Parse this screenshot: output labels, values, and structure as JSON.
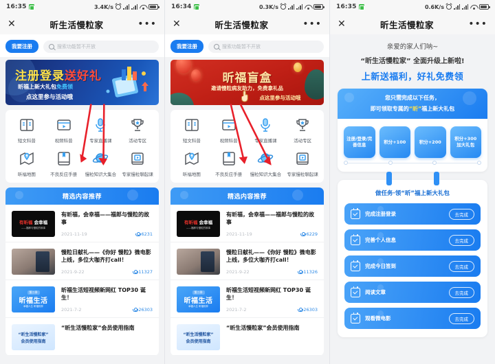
{
  "panels": [
    {
      "status": {
        "time": "16:35",
        "net_speed": "3.4K/s"
      },
      "title": "昕生活慢粒家",
      "close_label": "✕",
      "more_label": "•••",
      "register_button": "我要注册",
      "search_placeholder": "搜索功能暂不开放",
      "banner": {
        "kind": "blue",
        "title_part1": "注册登录",
        "title_part2": "送好礼",
        "subtitle_main": "昕福上新大礼包",
        "subtitle_accent": "免费领",
        "cta": "点这里参与活动哦"
      }
    },
    {
      "status": {
        "time": "16:34",
        "net_speed": "0.3K/s"
      },
      "title": "昕生活慢粒家",
      "close_label": "✕",
      "more_label": "•••",
      "register_button": "我要注册",
      "search_placeholder": "搜索功能暂不开放",
      "banner": {
        "kind": "red",
        "title": "昕福盲盒",
        "subtitle": "邀请慢粒病友助力，免费拿礼品",
        "cta": "点这里参与活动哦"
      }
    }
  ],
  "grid": {
    "items": [
      {
        "label": "短文科普",
        "icon": "book-open-icon"
      },
      {
        "label": "视频科普",
        "icon": "video-play-icon"
      },
      {
        "label": "专家直播课",
        "icon": "microphone-icon"
      },
      {
        "label": "活动专区",
        "icon": "trophy-icon"
      },
      {
        "label": "昕福地图",
        "icon": "map-pin-icon"
      },
      {
        "label": "不良反应手册",
        "icon": "handbook-icon"
      },
      {
        "label": "慢粒知识大集合",
        "icon": "planet-icon"
      },
      {
        "label": "专家慢粒聊起课",
        "icon": "book-play-icon"
      }
    ]
  },
  "recommend": {
    "header": "精选内容推荐",
    "items_left": [
      {
        "title": "有昕福，会幸福——福郎与慢粒的故事",
        "date": "2021-11-19",
        "views": "6231",
        "thumb": "black-title-card",
        "thumb_text_red": "有昕福",
        "thumb_text_white": "会幸福",
        "thumb_sub": "——福郎与慢粒的故事"
      },
      {
        "title": "慢粒日献礼——《你好 慢粒》微电影上线，多位大咖齐打call！",
        "date": "2021-9-22",
        "views": "11327",
        "thumb": "photo-card"
      },
      {
        "title": "昕福生活短视频新网红 TOP30 诞生！",
        "date": "2021-7-2",
        "views": "26303",
        "thumb": "blue-title-card",
        "thumb_season": "第二季",
        "thumb_main": "昕福生活",
        "thumb_sub": "幸福人生 昕福相伴"
      },
      {
        "title": "“昕生活慢粒家”会员使用指南",
        "date": "",
        "views": "",
        "thumb": "white-guide-card",
        "thumb_line1": "“昕生活慢粒家”",
        "thumb_line2": "会员使用指南"
      }
    ],
    "items_right": [
      {
        "title": "有昕福，会幸福——福郎与慢粒的故事",
        "date": "2021-11-19",
        "views": "6229",
        "thumb": "black-title-card",
        "thumb_text_red": "有昕福",
        "thumb_text_white": "会幸福",
        "thumb_sub": "——福郎与慢粒的故事"
      },
      {
        "title": "慢粒日献礼——《你好 慢粒》微电影上线，多位大咖齐打call！",
        "date": "2021-9-22",
        "views": "11326",
        "thumb": "photo-card"
      },
      {
        "title": "昕福生活短视频新网红 TOP30 诞生！",
        "date": "2021-7-2",
        "views": "26303",
        "thumb": "blue-title-card",
        "thumb_season": "第二季",
        "thumb_main": "昕福生活",
        "thumb_sub": "幸福人生 昕福相伴"
      },
      {
        "title": "“昕生活慢粒家”会员使用指南",
        "date": "",
        "views": "",
        "thumb": "white-guide-card",
        "thumb_line1": "“昕生活慢粒家”",
        "thumb_line2": "会员使用指南"
      }
    ]
  },
  "activity": {
    "status": {
      "time": "16:35",
      "net_speed": "0.6K/s"
    },
    "title": "昕生活慢粒家",
    "close_label": "✕",
    "more_label": "•••",
    "greeting": "亲爱的家人们呐~",
    "headline": "“昕生活慢粒家” 全面升级上新啦!",
    "subheadline": "上新送福利，好礼免费领",
    "card_head_line1": "您只需完成以下任务，",
    "card_head_line2_pre": "即可领取专属的",
    "card_head_line2_hl": "“昕”",
    "card_head_line2_post": "福上新大礼包",
    "steps": [
      "注册/登录/完善信息",
      "积分+100",
      "积分+200",
      "积分+300 加大礼包"
    ],
    "tasks_title": "做任务·领“昕”福上新大礼包",
    "task_action": "去完成",
    "tasks": [
      "完成注册登录",
      "完善个人信息",
      "完成今日签到",
      "阅读文章",
      "观看微电影"
    ]
  },
  "colors": {
    "accent_blue": "#1a7cf0",
    "banner_red": "#c02016",
    "highlight_yellow": "#ffe24a",
    "link_blue": "#2e8ae6"
  }
}
